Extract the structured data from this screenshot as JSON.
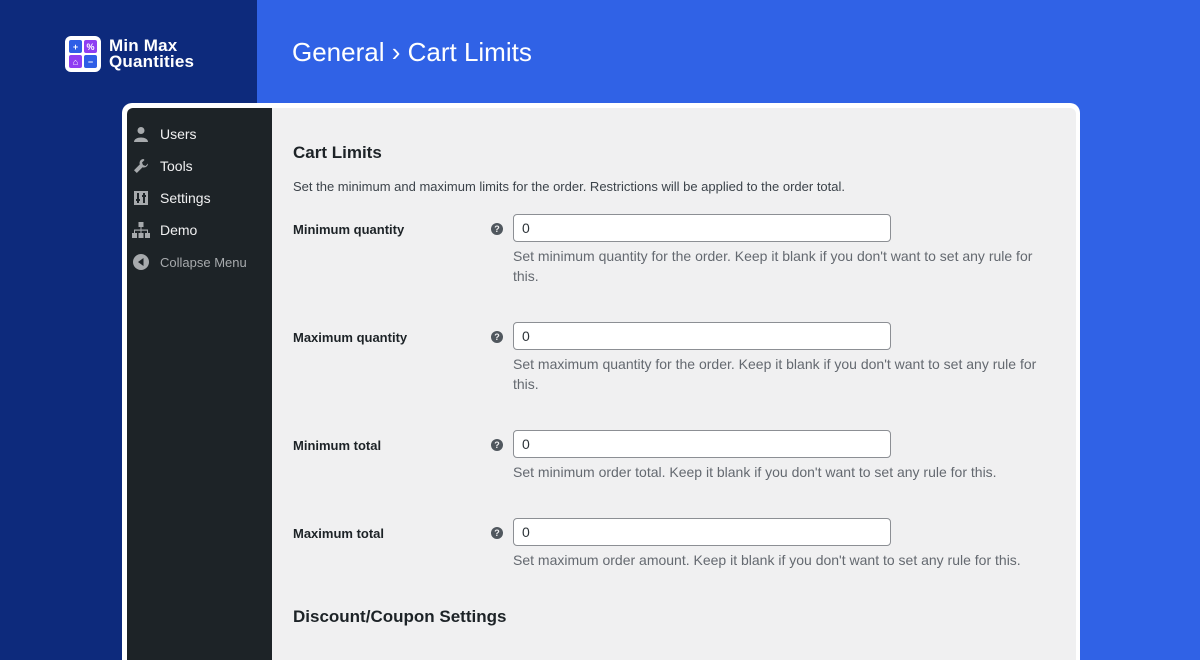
{
  "brand": {
    "name_line1": "Min Max",
    "name_line2": "Quantities",
    "logo_glyphs": [
      "+",
      "%",
      "⌂",
      "−"
    ]
  },
  "header": {
    "title": "General › Cart Limits"
  },
  "sidebar": {
    "items": [
      {
        "label": "Users",
        "icon": "user-icon"
      },
      {
        "label": "Tools",
        "icon": "wrench-icon"
      },
      {
        "label": "Settings",
        "icon": "sliders-icon"
      },
      {
        "label": "Demo",
        "icon": "sitemap-icon"
      },
      {
        "label": "Collapse Menu",
        "icon": "collapse-arrow-icon"
      }
    ]
  },
  "content": {
    "section_title": "Cart Limits",
    "section_desc": "Set the minimum and maximum limits for the order. Restrictions will be applied to the order total.",
    "fields": [
      {
        "label": "Minimum quantity",
        "value": "0",
        "help": "Set minimum quantity for the order. Keep it blank if you don't want to set any rule for this."
      },
      {
        "label": "Maximum quantity",
        "value": "0",
        "help": "Set maximum quantity for the order. Keep it blank if you don't want to set any rule for this."
      },
      {
        "label": "Minimum total",
        "value": "0",
        "help": "Set minimum order total. Keep it blank if you don't want to set any rule for this."
      },
      {
        "label": "Maximum total",
        "value": "0",
        "help": "Set maximum order amount. Keep it blank if you don't want to set any rule for this."
      }
    ],
    "help_glyph": "?",
    "next_section_title": "Discount/Coupon Settings"
  },
  "colors": {
    "background": "#3062e6",
    "left_band": "#0d2a7c",
    "sidebar": "#1d2327",
    "content_bg": "#f0f0f1",
    "logo_blue": "#2f5ee6",
    "logo_purple": "#8f3ef2"
  }
}
